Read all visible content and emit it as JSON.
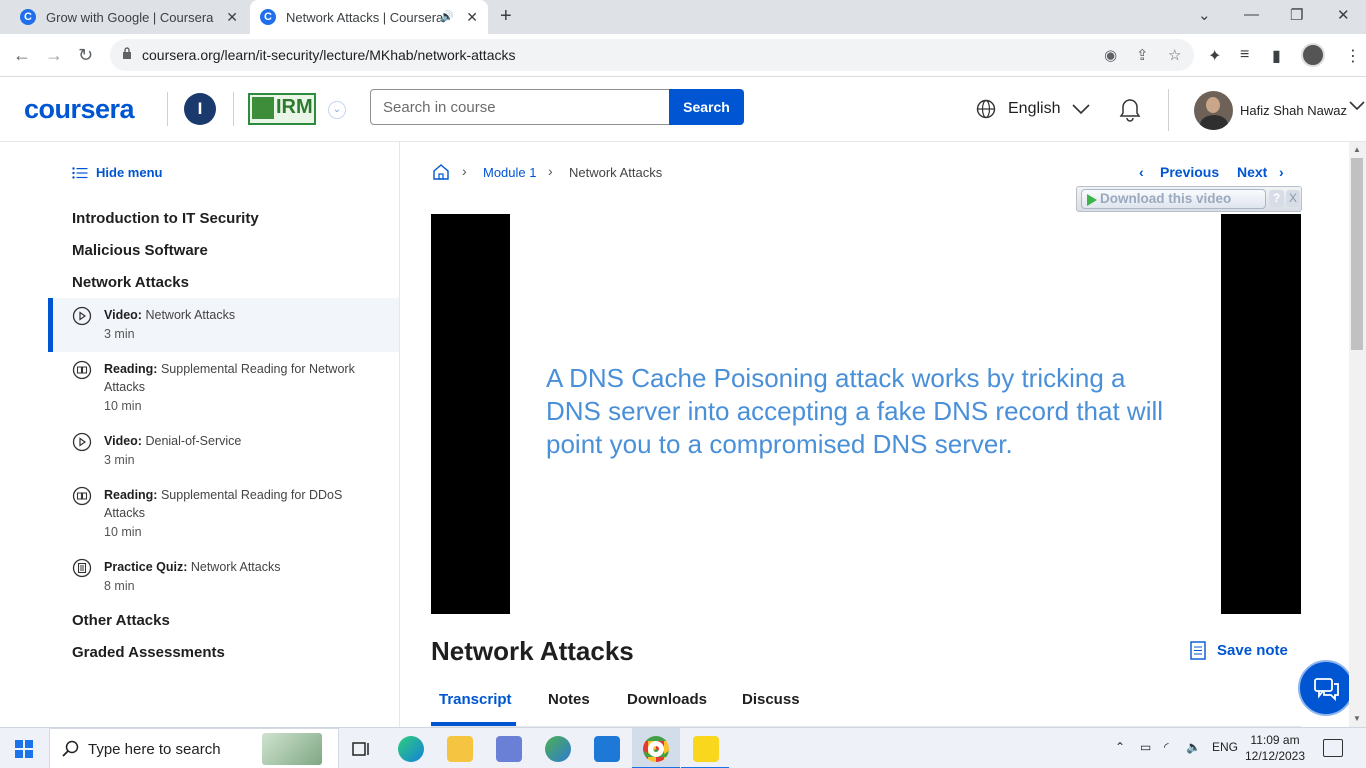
{
  "browser": {
    "tabs": [
      {
        "title": "Grow with Google | Coursera",
        "favicon": "coursera-icon"
      },
      {
        "title": "Network Attacks | Coursera",
        "favicon": "coursera-icon",
        "audio": true
      }
    ],
    "url": "coursera.org/learn/it-security/lecture/MKhab/network-attacks"
  },
  "header": {
    "logo": "coursera",
    "org_initial": "I",
    "org_logo_text": "IRM",
    "search_placeholder": "Search in course",
    "search_button": "Search",
    "language": "English",
    "user_name": "Hafiz Shah Nawaz"
  },
  "sidebar": {
    "hide_menu": "Hide menu",
    "modules": [
      "Introduction to IT Security",
      "Malicious Software",
      "Network Attacks"
    ],
    "items": [
      {
        "kind": "Video:",
        "title": "Network Attacks",
        "duration": "3 min",
        "icon": "play-circle-icon",
        "active": true
      },
      {
        "kind": "Reading:",
        "title": "Supplemental Reading for Network Attacks",
        "duration": "10 min",
        "icon": "book-icon"
      },
      {
        "kind": "Video:",
        "title": "Denial-of-Service",
        "duration": "3 min",
        "icon": "play-circle-icon"
      },
      {
        "kind": "Reading:",
        "title": "Supplemental Reading for DDoS Attacks",
        "duration": "10 min",
        "icon": "book-icon"
      },
      {
        "kind": "Practice Quiz:",
        "title": "Network Attacks",
        "duration": "8 min",
        "icon": "quiz-icon"
      }
    ],
    "modules_after": [
      "Other Attacks",
      "Graded Assessments"
    ]
  },
  "breadcrumb": {
    "module": "Module 1",
    "current": "Network Attacks"
  },
  "nav": {
    "previous": "Previous",
    "next": "Next"
  },
  "download_bar": {
    "label": "Download this video",
    "help": "?",
    "close": "X"
  },
  "video": {
    "caption": "A DNS Cache Poisoning attack works by tricking a DNS server into accepting a fake DNS record that will point you to a compromised DNS server."
  },
  "lecture": {
    "title": "Network Attacks",
    "save_note": "Save note",
    "tabs": [
      "Transcript",
      "Notes",
      "Downloads",
      "Discuss"
    ],
    "active_tab": "Transcript"
  },
  "taskbar": {
    "search_placeholder": "Type here to search",
    "language": "ENG",
    "time": "11:09 am",
    "date": "12/12/2023"
  },
  "colors": {
    "accent": "#0056d2",
    "caption": "#4a90d9"
  }
}
